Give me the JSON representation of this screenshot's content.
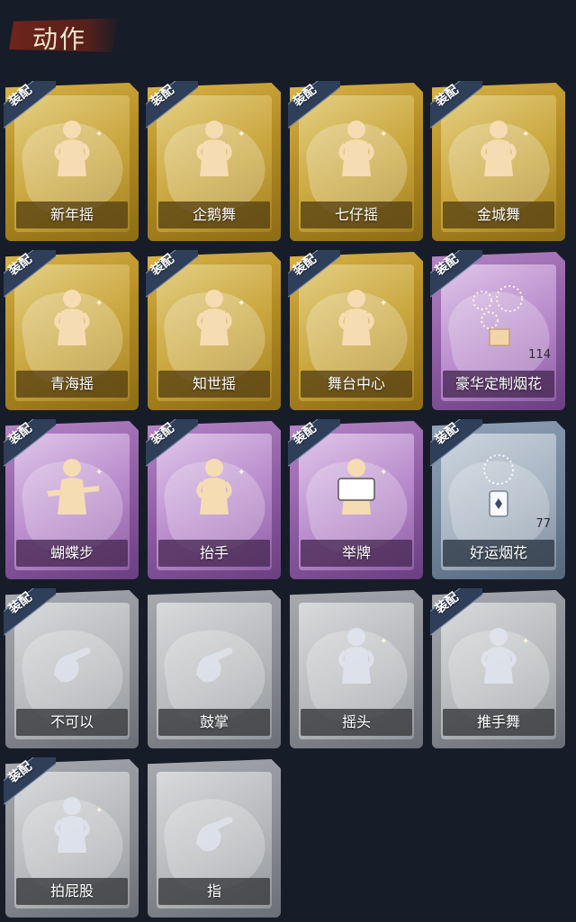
{
  "header": {
    "title": "动作"
  },
  "badge_label": "装配",
  "cards": [
    {
      "name": "新年摇",
      "rarity": "gold",
      "equipped": true,
      "icon": "figure-waving-icon"
    },
    {
      "name": "企鹅舞",
      "rarity": "gold",
      "equipped": true,
      "icon": "figure-dancing-icon"
    },
    {
      "name": "七仔摇",
      "rarity": "gold",
      "equipped": true,
      "icon": "figure-arm-cross-icon"
    },
    {
      "name": "金城舞",
      "rarity": "gold",
      "equipped": true,
      "icon": "figure-hand-up-icon"
    },
    {
      "name": "青海摇",
      "rarity": "gold",
      "equipped": true,
      "icon": "figure-shaking-icon"
    },
    {
      "name": "知世摇",
      "rarity": "gold",
      "equipped": true,
      "icon": "figure-arms-out-icon"
    },
    {
      "name": "舞台中心",
      "rarity": "gold",
      "equipped": true,
      "icon": "figure-sparkle-icon"
    },
    {
      "name": "豪华定制烟花",
      "rarity": "purple",
      "equipped": true,
      "icon": "fireworks-box-icon",
      "count": "114"
    },
    {
      "name": "蝴蝶步",
      "rarity": "purple",
      "equipped": true,
      "icon": "figure-pointing-icon"
    },
    {
      "name": "抬手",
      "rarity": "purple",
      "equipped": true,
      "icon": "figure-raise-hand-icon"
    },
    {
      "name": "举牌",
      "rarity": "purple",
      "equipped": true,
      "icon": "figure-sign-icon"
    },
    {
      "name": "好运烟花",
      "rarity": "blue",
      "equipped": true,
      "icon": "firework-can-icon",
      "count": "77"
    },
    {
      "name": "不可以",
      "rarity": "gray",
      "equipped": true,
      "icon": "finger-wag-icon"
    },
    {
      "name": "鼓掌",
      "rarity": "gray",
      "equipped": false,
      "icon": "clapping-hands-icon"
    },
    {
      "name": "摇头",
      "rarity": "gray",
      "equipped": false,
      "icon": "figure-head-shake-icon"
    },
    {
      "name": "推手舞",
      "rarity": "gray",
      "equipped": true,
      "icon": "figure-push-dance-icon"
    },
    {
      "name": "拍屁股",
      "rarity": "gray",
      "equipped": true,
      "icon": "figure-pat-icon"
    },
    {
      "name": "指",
      "rarity": "gray",
      "equipped": false,
      "icon": "pointing-hand-icon"
    }
  ]
}
